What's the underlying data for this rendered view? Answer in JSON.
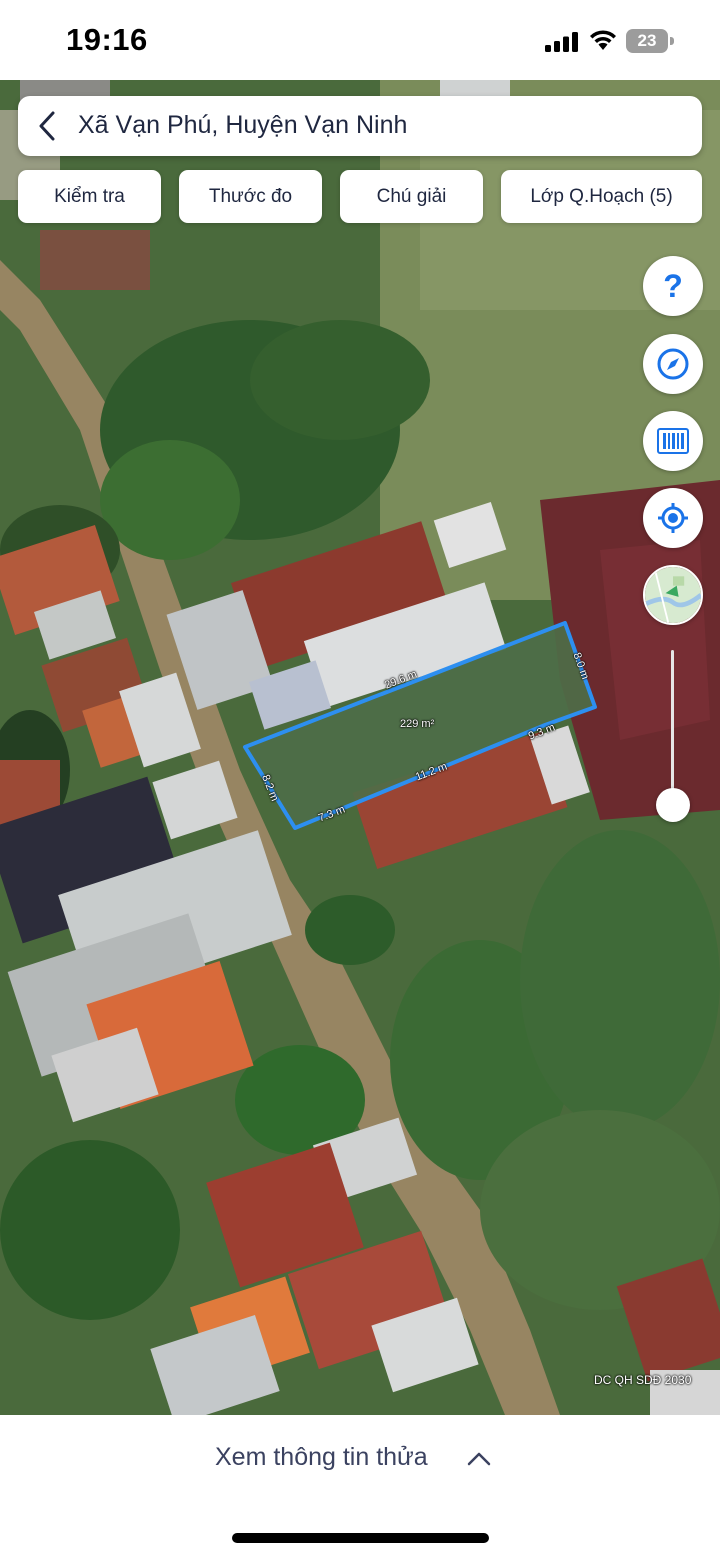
{
  "status_bar": {
    "time": "19:16",
    "battery_level": "23",
    "icons": [
      "signal-icon",
      "wifi-icon",
      "battery-icon"
    ]
  },
  "search": {
    "location": "Xã Vạn Phú, Huyện Vạn Ninh",
    "back_icon": "chevron-left-icon"
  },
  "toolbar": {
    "buttons": [
      {
        "label": "Kiểm tra"
      },
      {
        "label": "Thước đo"
      },
      {
        "label": "Chú giải"
      },
      {
        "label": "Lớp Q.Hoạch (5)"
      }
    ]
  },
  "side_controls": {
    "icons": [
      "help-icon",
      "compass-icon",
      "barcode-icon",
      "locate-icon",
      "map-layer-thumbnail"
    ],
    "zoom_level_fraction": 0.9
  },
  "plot": {
    "area": "229 m²",
    "edges": [
      "29.6 m",
      "8.0 m",
      "9.3 m",
      "11.2 m",
      "7.3 m",
      "8.2 m"
    ],
    "outline_color": "#2d8ff0"
  },
  "map": {
    "credit": "DC QH SDĐ 2030"
  },
  "bottom_panel": {
    "label": "Xem thông tin thửa",
    "chevron_icon": "chevron-up-icon"
  }
}
